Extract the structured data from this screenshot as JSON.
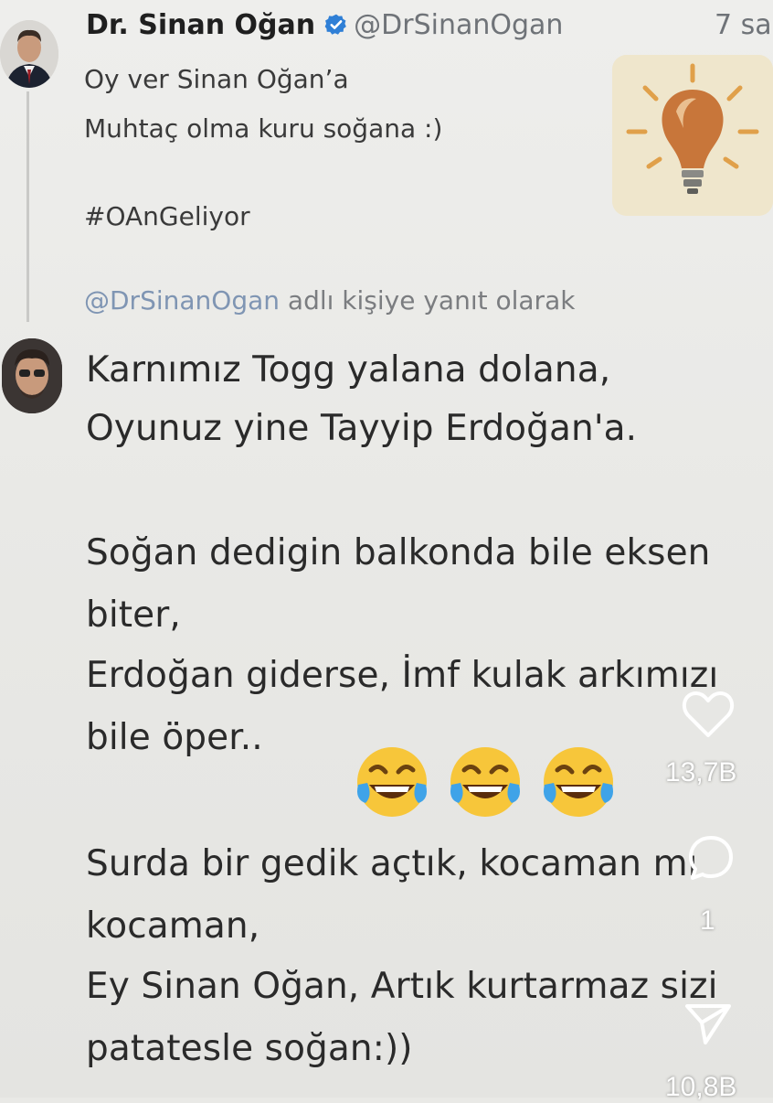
{
  "original_tweet": {
    "author_name": "Dr. Sinan Oğan",
    "handle": "@DrSinanOgan",
    "time": "7 sa",
    "lines": [
      "Oy ver Sinan Oğan’a",
      "Muhtaç olma kuru soğana :)",
      "#OAnGeliyor"
    ]
  },
  "reply_context": {
    "mention": "@DrSinanOgan",
    "text": "adlı kişiye yanıt olarak"
  },
  "reply": {
    "lines": [
      "Karnımız Togg yalana dolana,",
      "Oyunuz yine Tayyip Erdoğan'a.",
      "Soğan dedigin balkonda bile eksen",
      "biter,",
      "Erdoğan giderse, İmf kulak arkımızı",
      "bile öper..",
      "Surda bir gedik açtık, kocaman mı",
      "kocaman,",
      "Ey Sinan Oğan, Artık kurtarmaz sizi",
      "patatesle soğan:))"
    ],
    "emojis": [
      "face-with-tears-of-joy",
      "face-with-tears-of-joy",
      "face-with-tears-of-joy"
    ]
  },
  "overlay_actions": {
    "like_count": "13,7B",
    "comment_count": "1",
    "share_count": "10,8B"
  },
  "icons": {
    "like": "heart-icon",
    "comment": "comment-icon",
    "share": "send-icon",
    "verified": "verified-badge-icon"
  },
  "colors": {
    "verified_blue": "#2f7fd6",
    "handle_gray": "#6f7378",
    "mention_blue": "#7f95b3"
  }
}
